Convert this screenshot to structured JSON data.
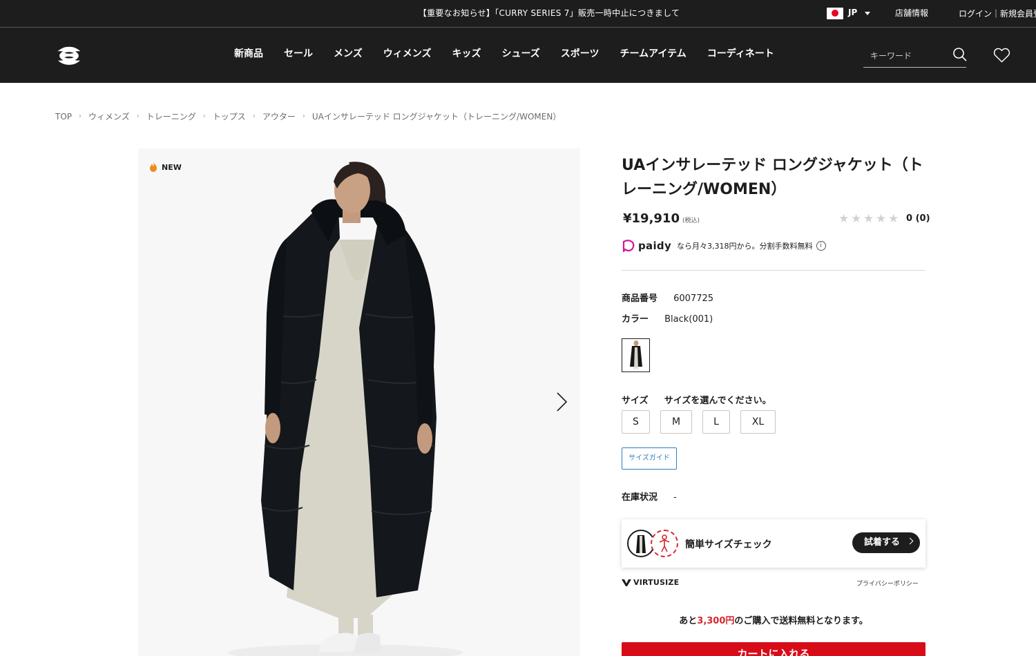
{
  "topbar": {
    "notice": "【重要なお知らせ】「CURRY SERIES 7」販売一時中止につきまして",
    "lang": "JP",
    "store": "店舗情報",
    "login": "ログイン｜新規会員登"
  },
  "nav": {
    "items": [
      "新商品",
      "セール",
      "メンズ",
      "ウィメンズ",
      "キッズ",
      "シューズ",
      "スポーツ",
      "チームアイテム",
      "コーディネート"
    ],
    "search_placeholder": "キーワード"
  },
  "breadcrumb": [
    "TOP",
    "ウィメンズ",
    "トレーニング",
    "トップス",
    "アウター",
    "UAインサレーテッド ロングジャケット（トレーニング/WOMEN）"
  ],
  "product": {
    "badge": "NEW",
    "title": "UAインサレーテッド ロングジャケット（トレーニング/WOMEN）",
    "price": "¥19,910",
    "price_tax": "(税込)",
    "rating_stars": 0,
    "review_count": "0",
    "review_paren": "(0)",
    "paidy": {
      "word": "paidy",
      "text": "なら月々3,318円から。分割手数料無料"
    },
    "sku_label": "商品番号",
    "sku": "6007725",
    "color_label": "カラー",
    "color": "Black(001)",
    "size_label": "サイズ",
    "size_prompt": "サイズを選んでください。",
    "sizes": [
      "S",
      "M",
      "L",
      "XL"
    ],
    "size_guide": "サイズガイド",
    "stock_label": "在庫状況",
    "stock": "-"
  },
  "virtusize": {
    "text": "簡単サイズチェック",
    "button": "試着する",
    "logo": "VIRTUSIZE",
    "privacy": "プライバシーポリシー"
  },
  "shipping": {
    "prefix": "あと",
    "amount": "3,300円",
    "suffix": "のご購入で送料無料となります。"
  },
  "cart": {
    "label": "カートに入れる"
  },
  "colors": {
    "header_bg": "#1d1d1d",
    "accent_red": "#d80c18",
    "link_blue": "#2b7fbf"
  }
}
